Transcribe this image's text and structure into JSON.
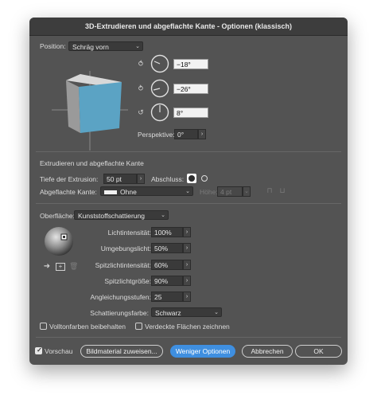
{
  "dialog": {
    "title": "3D-Extrudieren und abgeflachte Kante - Optionen (klassisch)"
  },
  "position": {
    "label": "Position:",
    "value": "Schräg vorn",
    "rotation_x": "−18°",
    "rotation_y": "−26°",
    "rotation_z": "8°",
    "perspective_label": "Perspektive:",
    "perspective_value": "0°",
    "cube_face_color": "#5ba3c4"
  },
  "extrude": {
    "section_title": "Extrudieren und abgeflachte Kante",
    "depth_label": "Tiefe der Extrusion:",
    "depth_value": "50 pt",
    "cap_label": "Abschluss:",
    "bevel_label": "Abgeflachte Kante:",
    "bevel_value": "Ohne",
    "height_label": "Höhe:",
    "height_value": "4 pt"
  },
  "surface": {
    "label": "Oberfläche:",
    "value": "Kunststoffschattierung",
    "light_intensity_label": "Lichtintensität:",
    "light_intensity_value": "100%",
    "ambient_light_label": "Umgebungslicht:",
    "ambient_light_value": "50%",
    "highlight_intensity_label": "Spitzlichtintensität:",
    "highlight_intensity_value": "60%",
    "highlight_size_label": "Spitzlichtgröße:",
    "highlight_size_value": "90%",
    "blend_steps_label": "Angleichungsstufen:",
    "blend_steps_value": "25",
    "shading_color_label": "Schattierungsfarbe:",
    "shading_color_value": "Schwarz",
    "preserve_spot_label": "Volltonfarben beibehalten",
    "draw_hidden_label": "Verdeckte Flächen zeichnen"
  },
  "footer": {
    "preview_label": "Vorschau",
    "map_art_label": "Bildmaterial zuweisen...",
    "fewer_options_label": "Weniger Optionen",
    "cancel_label": "Abbrechen",
    "ok_label": "OK"
  },
  "colors": {
    "dialog_bg": "#535353",
    "accent": "#3f8fe0"
  }
}
